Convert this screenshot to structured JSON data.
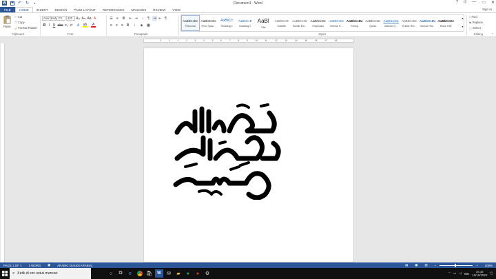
{
  "title_bar": {
    "doc_title": "Document1 - Word",
    "help": "?",
    "minimize": "—",
    "restore": "▭",
    "close": "✕"
  },
  "tabs": [
    "FILE",
    "HOME",
    "INSERT",
    "DESIGN",
    "PAGE LAYOUT",
    "REFERENCES",
    "MAILINGS",
    "REVIEW",
    "VIEW"
  ],
  "sign_in": "Sign in",
  "clipboard": {
    "paste": "Paste",
    "cut": "Cut",
    "copy": "Copy",
    "format_painter": "Format Painter",
    "label": "Clipboard"
  },
  "font": {
    "name": "Arial (Body CS",
    "size": "420",
    "label": "Font"
  },
  "paragraph": {
    "label": "Paragraph"
  },
  "styles": {
    "label": "Styles",
    "items": [
      {
        "preview": "AaBbCcDc",
        "name": "¶ Normal"
      },
      {
        "preview": "AaBbCcDc",
        "name": "¶ No Spac..."
      },
      {
        "preview": "AaBbCc",
        "name": "Heading 1"
      },
      {
        "preview": "AaBbCcE",
        "name": "Heading 2"
      },
      {
        "preview": "AaBl",
        "name": "Title"
      },
      {
        "preview": "AaBbCcD",
        "name": "Subtitle"
      },
      {
        "preview": "AaBbCcDc",
        "name": "Subtle Em..."
      },
      {
        "preview": "AaBbCcDc",
        "name": "Emphasis"
      },
      {
        "preview": "AaBbCcDc",
        "name": "Intense E..."
      },
      {
        "preview": "AaBbCcDc",
        "name": "Strong"
      },
      {
        "preview": "AaBbCcDc",
        "name": "Quote"
      },
      {
        "preview": "AaBbCcDc",
        "name": "Intense Q..."
      },
      {
        "preview": "AaBbCcDc",
        "name": "Subtle Ref..."
      },
      {
        "preview": "AaBbCcDc",
        "name": "Intense Re..."
      },
      {
        "preview": "AaBbCcDc",
        "name": "Book Title"
      }
    ]
  },
  "editing": {
    "find": "Find",
    "replace": "Replace",
    "select": "Select",
    "label": "Editing"
  },
  "ruler": [
    "2",
    "1",
    "1",
    "2",
    "3",
    "4",
    "5",
    "6",
    "7",
    "8",
    "9",
    "10",
    "11",
    "12",
    "13",
    "14",
    "15",
    "16",
    "17",
    "18"
  ],
  "status_bar": {
    "page": "PAGE 1 OF 1",
    "words": "1 WORD",
    "language": "ARABIC (SAUDI ARABIA)",
    "zoom": "100%"
  },
  "taskbar": {
    "search_placeholder": "Ketik di sini untuk mencari",
    "language": "IND",
    "time": "16.32",
    "date": "10/10/2020"
  }
}
